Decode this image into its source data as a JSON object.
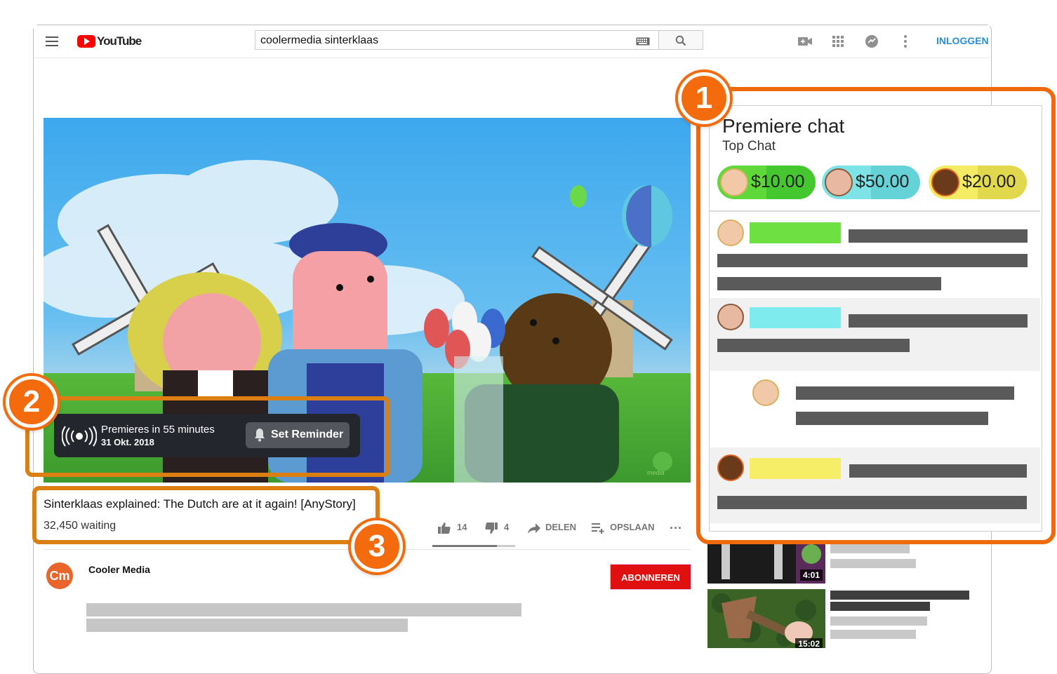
{
  "header": {
    "logo_text": "YouTube",
    "search_value": "coolermedia sinterklaas",
    "signin_label": "INLOGGEN",
    "icons": [
      "menu-icon",
      "keyboard-icon",
      "search-icon",
      "create-video-icon",
      "apps-grid-icon",
      "messages-icon",
      "more-vertical-icon"
    ]
  },
  "video": {
    "premiere_text": "Premieres in 55 minutes",
    "premiere_date": "31 Okt. 2018",
    "reminder_label": "Set Reminder",
    "title": "Sinterklaas explained: The Dutch are at it again! [AnyStory]",
    "waiting": "32,450 waiting",
    "likes": "14",
    "dislikes": "4",
    "like_ratio": 0.78,
    "share_label": "DELEN",
    "save_label": "OPSLAAN",
    "more_label": "...",
    "watermark_label": "media"
  },
  "channel": {
    "avatar_text": "Cm",
    "name": "Cooler Media",
    "subscribe_label": "ABONNEREN"
  },
  "chat": {
    "title": "Premiere chat",
    "mode": "Top Chat",
    "superchats": [
      {
        "amount": "$10.00",
        "color": "#5fd83a",
        "tail": "#45c72f"
      },
      {
        "amount": "$50.00",
        "color": "#7ee3e6",
        "tail": "#64d2d6"
      },
      {
        "amount": "$20.00",
        "color": "#f4ec63",
        "tail": "#e2d84e"
      }
    ],
    "name_colors": [
      "#6ee042",
      "#7eecef",
      "#f5ee66"
    ]
  },
  "annotations": [
    "1",
    "2",
    "3"
  ],
  "sidebar": {
    "durations": [
      "4:01",
      "15:02"
    ]
  }
}
